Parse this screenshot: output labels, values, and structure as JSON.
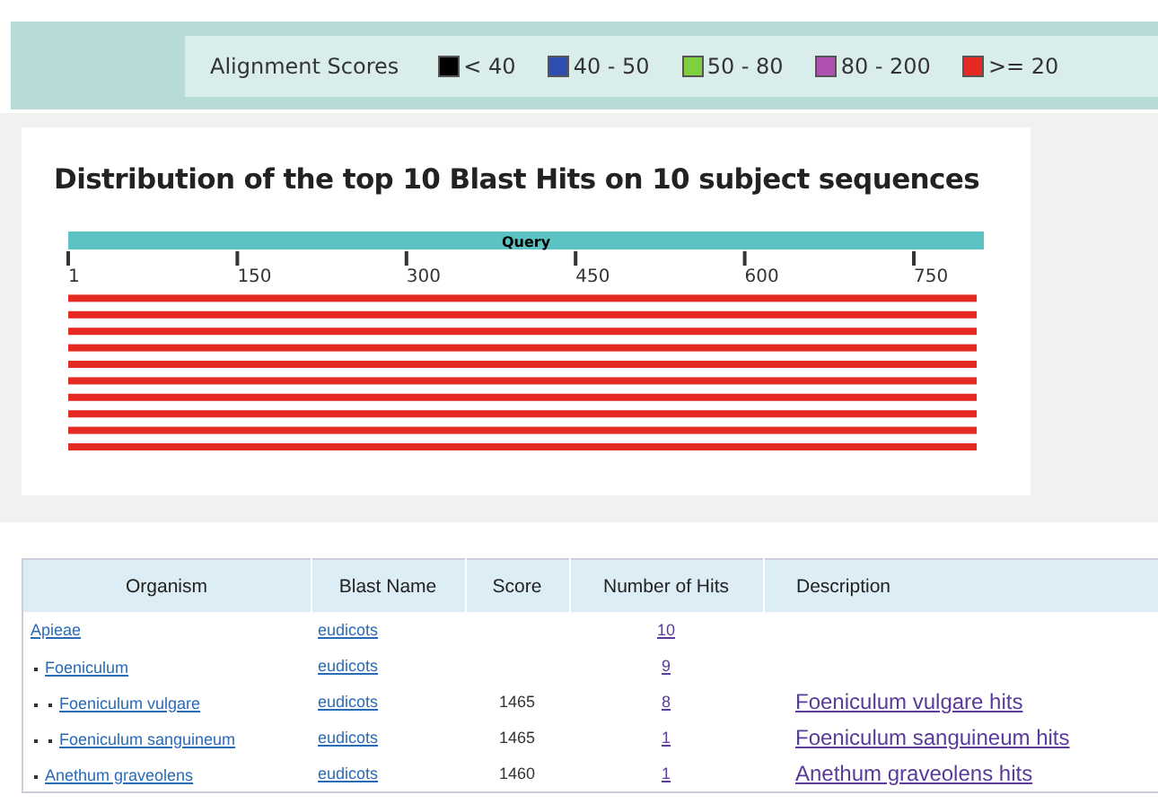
{
  "legend": {
    "title": "Alignment Scores",
    "items": [
      {
        "label": "< 40",
        "color": "#000000"
      },
      {
        "label": "40 - 50",
        "color": "#2f4fb0"
      },
      {
        "label": "50 - 80",
        "color": "#7fcf3f"
      },
      {
        "label": "80 - 200",
        "color": "#b050b0"
      },
      {
        "label": ">= 20",
        "color": "#e52a24"
      }
    ]
  },
  "graphic": {
    "title": "Distribution of the top 10 Blast Hits on 10 subject sequences",
    "query_label": "Query",
    "axis_ticks": [
      "1",
      "150",
      "300",
      "450",
      "600",
      "750"
    ]
  },
  "table": {
    "columns": [
      "Organism",
      "Blast Name",
      "Score",
      "Number of Hits",
      "Description"
    ],
    "rows": [
      {
        "organism": "Apieae",
        "blast_name": "eudicots",
        "hits": "10",
        "children": [
          {
            "organism": "Foeniculum",
            "blast_name": "eudicots",
            "hits": "9",
            "children": [
              {
                "organism": "Foeniculum vulgare",
                "blast_name": "eudicots",
                "score": "1465",
                "hits": "8",
                "description": "Foeniculum vulgare hits"
              },
              {
                "organism": "Foeniculum sanguineum",
                "blast_name": "eudicots",
                "score": "1465",
                "hits": "1",
                "description": "Foeniculum sanguineum hits"
              }
            ]
          },
          {
            "organism": "Anethum graveolens",
            "blast_name": "eudicots",
            "score": "1460",
            "hits": "1",
            "description": "Anethum graveolens hits"
          }
        ]
      }
    ]
  }
}
